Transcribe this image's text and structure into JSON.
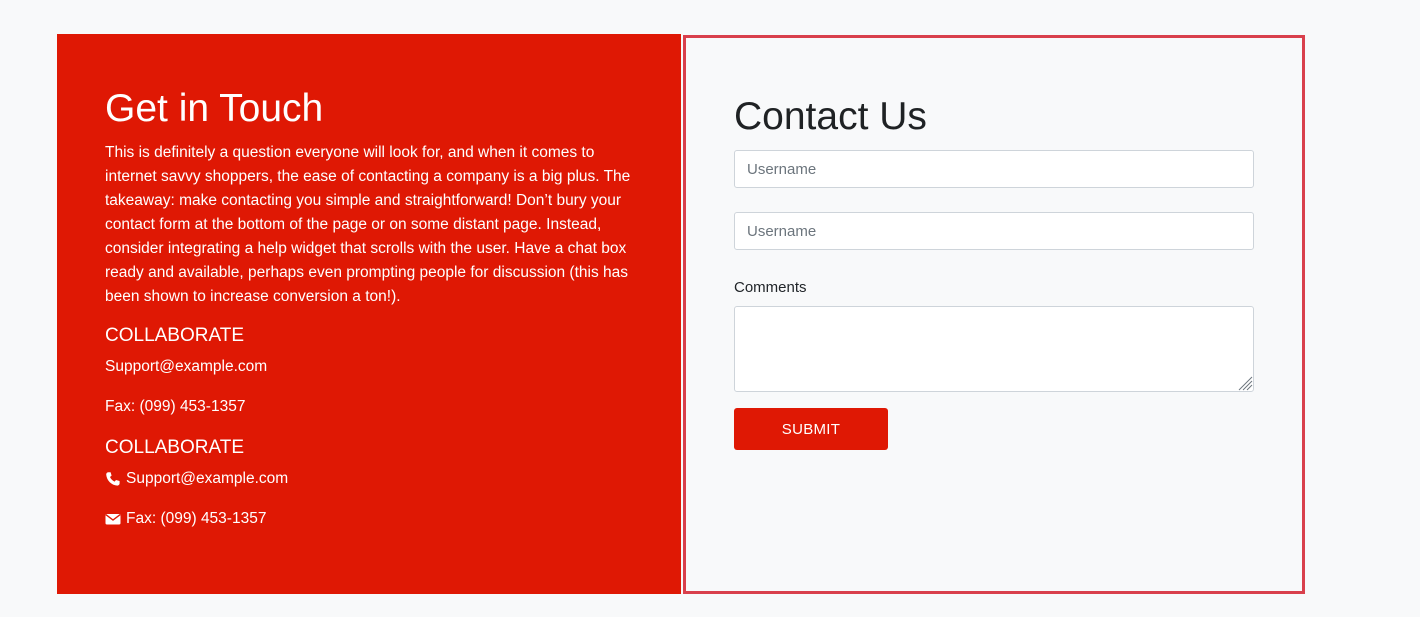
{
  "left": {
    "title": "Get in Touch",
    "body": "This is definitely a question everyone will look for, and when it comes to internet savvy shoppers, the ease of contacting a company is a big plus. The takeaway: make contacting you simple and straightforward! Don’t bury your contact form at the bottom of the page or on some distant page. Instead, consider integrating a help widget that scrolls with the user. Have a chat box ready and available, perhaps even prompting people for discussion (this has been shown to increase conversion a ton!).",
    "sections": [
      {
        "heading": "COLLABORATE",
        "email": "Support@example.com",
        "fax": "Fax: (099) 453-1357"
      },
      {
        "heading": "COLLABORATE",
        "email": "Support@example.com",
        "fax": "Fax: (099) 453-1357",
        "email_icon": "phone-icon",
        "fax_icon": "envelope-icon"
      }
    ]
  },
  "form": {
    "title": "Contact Us",
    "field1_placeholder": "Username",
    "field2_placeholder": "Username",
    "comments_label": "Comments",
    "submit_label": "SUBMIT"
  },
  "colors": {
    "accent": "#df1804",
    "form_border": "#d9404c",
    "page_background": "#f8f9fa"
  }
}
